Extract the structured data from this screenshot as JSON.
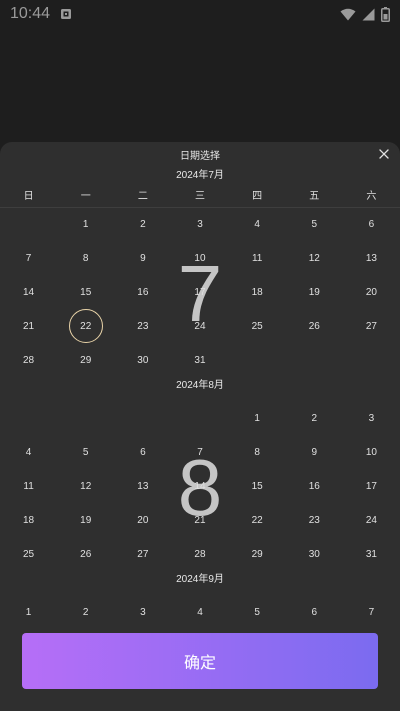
{
  "status_bar": {
    "time": "10:44"
  },
  "header": {
    "title": "日期选择"
  },
  "weekdays": [
    "日",
    "一",
    "二",
    "三",
    "四",
    "五",
    "六"
  ],
  "months": [
    {
      "title": "2024年7月",
      "watermark": "7",
      "leading_blanks": 1,
      "days": [
        "1",
        "2",
        "3",
        "4",
        "5",
        "6",
        "7",
        "8",
        "9",
        "10",
        "11",
        "12",
        "13",
        "14",
        "15",
        "16",
        "17",
        "18",
        "19",
        "20",
        "21",
        "22",
        "23",
        "24",
        "25",
        "26",
        "27",
        "28",
        "29",
        "30",
        "31"
      ],
      "selected": "22"
    },
    {
      "title": "2024年8月",
      "watermark": "8",
      "leading_blanks": 4,
      "days": [
        "1",
        "2",
        "3",
        "4",
        "5",
        "6",
        "7",
        "8",
        "9",
        "10",
        "11",
        "12",
        "13",
        "14",
        "15",
        "16",
        "17",
        "18",
        "19",
        "20",
        "21",
        "22",
        "23",
        "24",
        "25",
        "26",
        "27",
        "28",
        "29",
        "30",
        "31"
      ],
      "selected": ""
    },
    {
      "title": "2024年9月",
      "watermark": "",
      "leading_blanks": 0,
      "days": [
        "1",
        "2",
        "3",
        "4",
        "5",
        "6",
        "7"
      ],
      "selected": ""
    }
  ],
  "confirm_label": "确定",
  "colors": {
    "accent_start": "#b66ef7",
    "accent_end": "#7b6bf0",
    "selected_ring": "#e8d3a8"
  }
}
